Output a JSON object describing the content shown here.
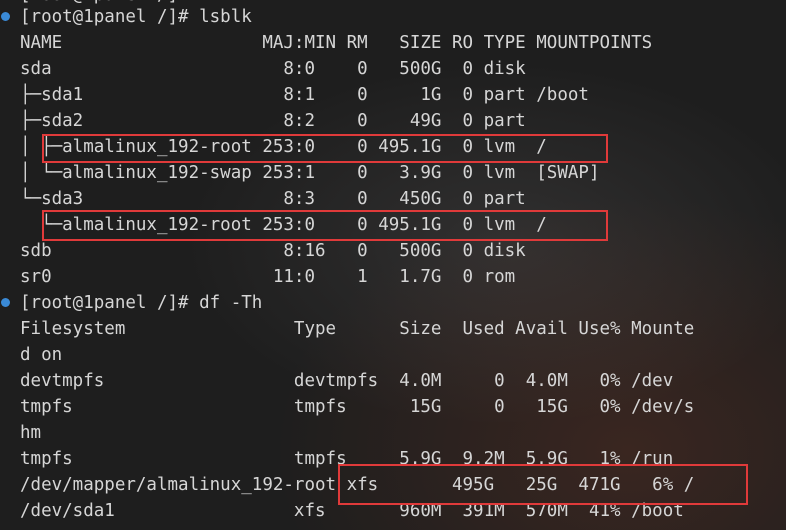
{
  "terminal": {
    "colors": {
      "background": "#1e1e1e",
      "text": "#d6d6d6",
      "prompt_bullet": "#3a8ad6",
      "highlight_box": "#e03a3a"
    },
    "top_partial_line": "[root@1panel /]#",
    "lsblk": {
      "prompt": "[root@1panel /]# lsblk",
      "header": "NAME                   MAJ:MIN RM   SIZE RO TYPE MOUNTPOINTS",
      "rows": [
        "sda                      8:0    0   500G  0 disk",
        "├─sda1                   8:1    0     1G  0 part /boot",
        "├─sda2                   8:2    0    49G  0 part",
        "│ ├─almalinux_192-root 253:0    0 495.1G  0 lvm  /",
        "│ └─almalinux_192-swap 253:1    0   3.9G  0 lvm  [SWAP]",
        "└─sda3                   8:3    0   450G  0 part",
        "  └─almalinux_192-root 253:0    0 495.1G  0 lvm  /",
        "sdb                      8:16   0   500G  0 disk",
        "sr0                     11:0    1   1.7G  0 rom"
      ]
    },
    "df": {
      "prompt": "[root@1panel /]# df -Th",
      "header_line1": "Filesystem                Type      Size  Used Avail Use% Mounte",
      "header_line2": "d on",
      "rows": [
        "devtmpfs                  devtmpfs  4.0M     0  4.0M   0% /dev",
        "tmpfs                     tmpfs      15G     0   15G   0% /dev/s",
        "hm",
        "tmpfs                     tmpfs     5.9G  9.2M  5.9G   1% /run",
        "/dev/mapper/almalinux_192-root xfs       495G   25G  471G   6% /",
        "/dev/sda1                 xfs       960M  391M  570M  41% /boot"
      ]
    }
  }
}
